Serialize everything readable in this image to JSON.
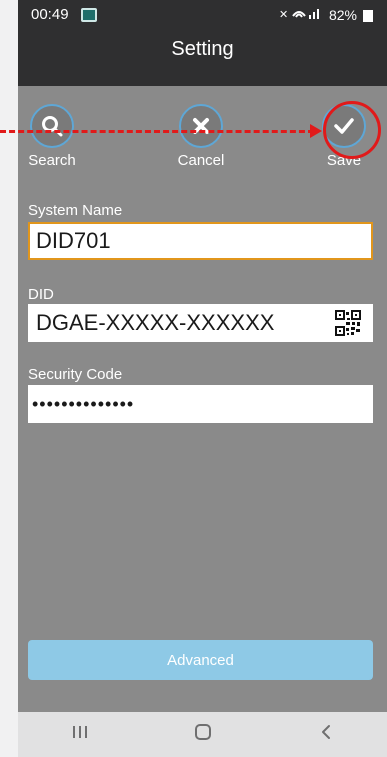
{
  "status_bar": {
    "time": "00:49",
    "signal_text": "ℕ⧗ ∷▐",
    "battery": "82%"
  },
  "header": {
    "title": "Setting"
  },
  "toolbar": {
    "search_label": "Search",
    "cancel_label": "Cancel",
    "save_label": "Save"
  },
  "form": {
    "system_name_label": "System Name",
    "system_name_value": "DID701",
    "did_label": "DID",
    "did_value": "DGAE-XXXXX-XXXXXX",
    "security_code_label": "Security Code",
    "security_code_value": "••••••••••••••"
  },
  "advanced_label": "Advanced",
  "icons": {
    "search": "search-icon",
    "cancel": "close-icon",
    "save": "checkmark-icon",
    "qr": "qr-code-icon",
    "recents": "recents-icon",
    "home": "home-icon",
    "back": "back-icon"
  },
  "colors": {
    "header_bg": "#2f2f30",
    "screen_bg": "#8a8a8a",
    "accent_blue": "#5ea7d6",
    "advanced_button": "#8ec9e6",
    "focus_border": "#e1961c",
    "annotation_red": "#e11a1a"
  }
}
